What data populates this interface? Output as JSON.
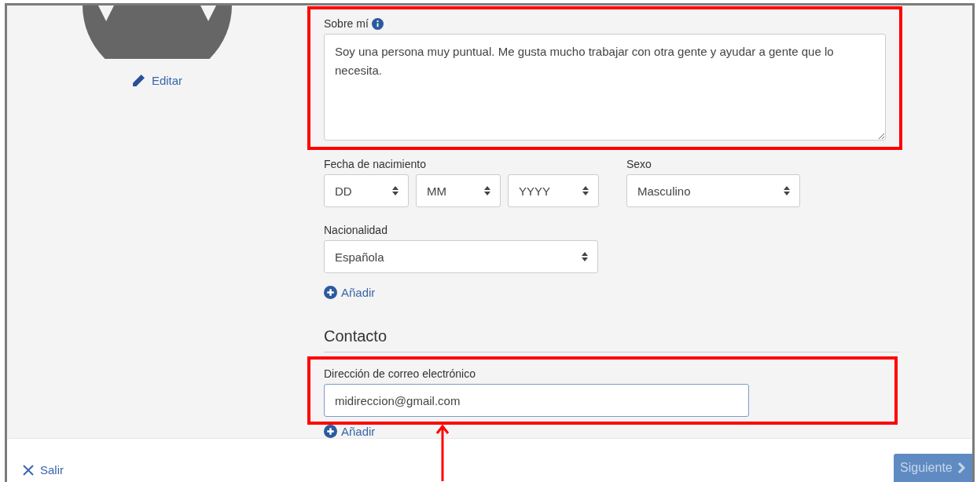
{
  "avatar": {
    "edit_link": "Editar"
  },
  "about": {
    "label": "Sobre mí",
    "value": "Soy una persona muy puntual. Me gusta mucho trabajar con otra gente y ayudar a gente que lo necesita.",
    "highlighted": true
  },
  "birth_date": {
    "label": "Fecha de nacimiento",
    "fields": [
      "DD",
      "MM",
      "YYYY"
    ]
  },
  "sex": {
    "label": "Sexo",
    "value": "Masculino"
  },
  "nationality": {
    "label": "Nacionalidad",
    "value": "Española",
    "add_link": "Añadir"
  },
  "contact": {
    "heading": "Contacto",
    "email": {
      "label": "Dirección de correo electrónico",
      "value": "midireccion@gmail.com",
      "highlighted": true
    },
    "add_link": "Añadir"
  },
  "footer": {
    "exit_button": "Salir",
    "next_button": {
      "label": "Siguiente",
      "disabled": true
    }
  }
}
